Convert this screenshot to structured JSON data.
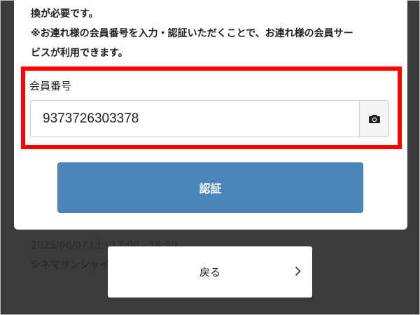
{
  "notice": {
    "line1": "換が必要です。",
    "line2": "※お連れ様の会員番号を入力・認証いただくことで、お連れ様の会員サー",
    "line3": "ビスが利用できます。"
  },
  "member_field": {
    "label": "会員番号",
    "value": "9373726303378",
    "camera_icon": "camera-icon"
  },
  "auth_button": {
    "label": "認証"
  },
  "background_screening": {
    "datetime": "2025/06/07 (土) 17:00 - 18:30",
    "theater": "シネマサンシャイ"
  },
  "back_button": {
    "label": "戻る",
    "icon": "chevron-right-icon"
  },
  "colors": {
    "highlight": "#ff0000",
    "primary_button": "#4a85bb",
    "overlay": "#3b3b3b"
  }
}
